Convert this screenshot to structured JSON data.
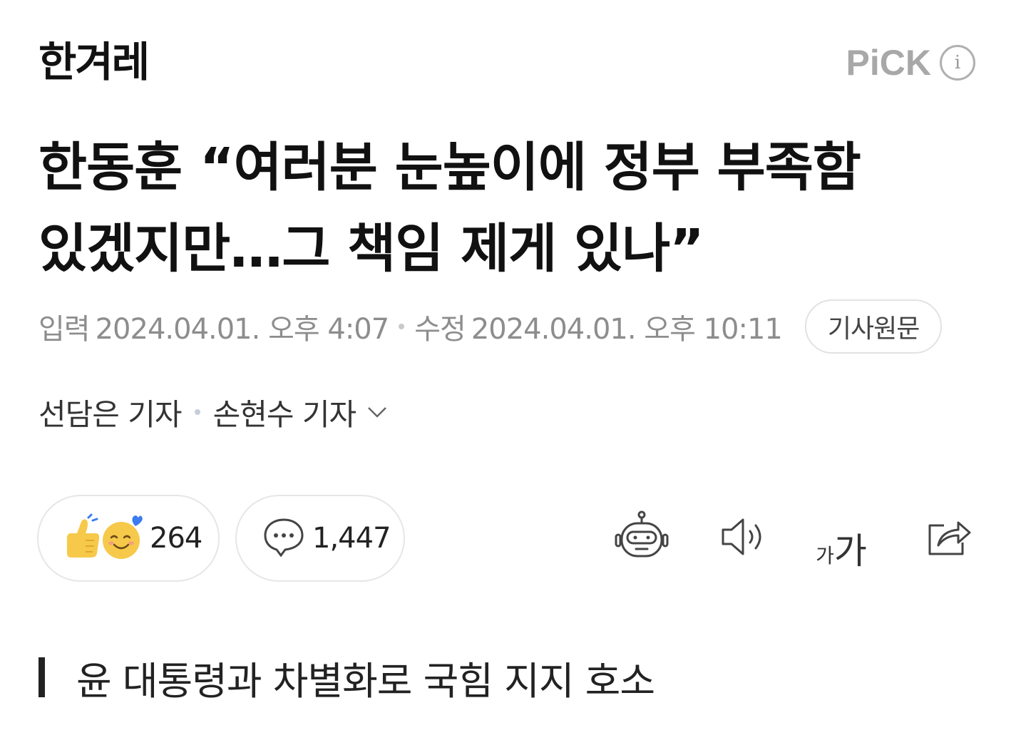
{
  "header": {
    "press_name": "한겨레",
    "pick_label": "PiCK",
    "info_icon": "info-icon"
  },
  "article": {
    "title_line1": "한동훈 “여러분 눈높이에 정부 부족함",
    "title_line2": "있겠지만…그 책임 제게 있나”",
    "input_label": "입력",
    "input_datetime": "2024.04.01. 오후 4:07",
    "modified_label": "수정",
    "modified_datetime": "2024.04.01. 오후 10:11",
    "origin_button": "기사원문",
    "reporter1": "선담은 기자",
    "reporter2": "손현수 기자",
    "subheading": "윤 대통령과 차별화로 국힘 지지 호소"
  },
  "actions": {
    "reaction_count": "264",
    "comment_count": "1,447",
    "font_small": "가",
    "font_big": "가",
    "icons": [
      "reaction-thumbs-icon",
      "comment-bubble-icon",
      "summary-bot-icon",
      "speaker-icon",
      "font-size-icon",
      "share-icon"
    ]
  },
  "colors": {
    "text": "#111111",
    "meta": "#8d8d8d",
    "pick": "#a8a8a8",
    "emoji_yellow": "#f6c94a",
    "heart_blue": "#3b7cf0"
  }
}
